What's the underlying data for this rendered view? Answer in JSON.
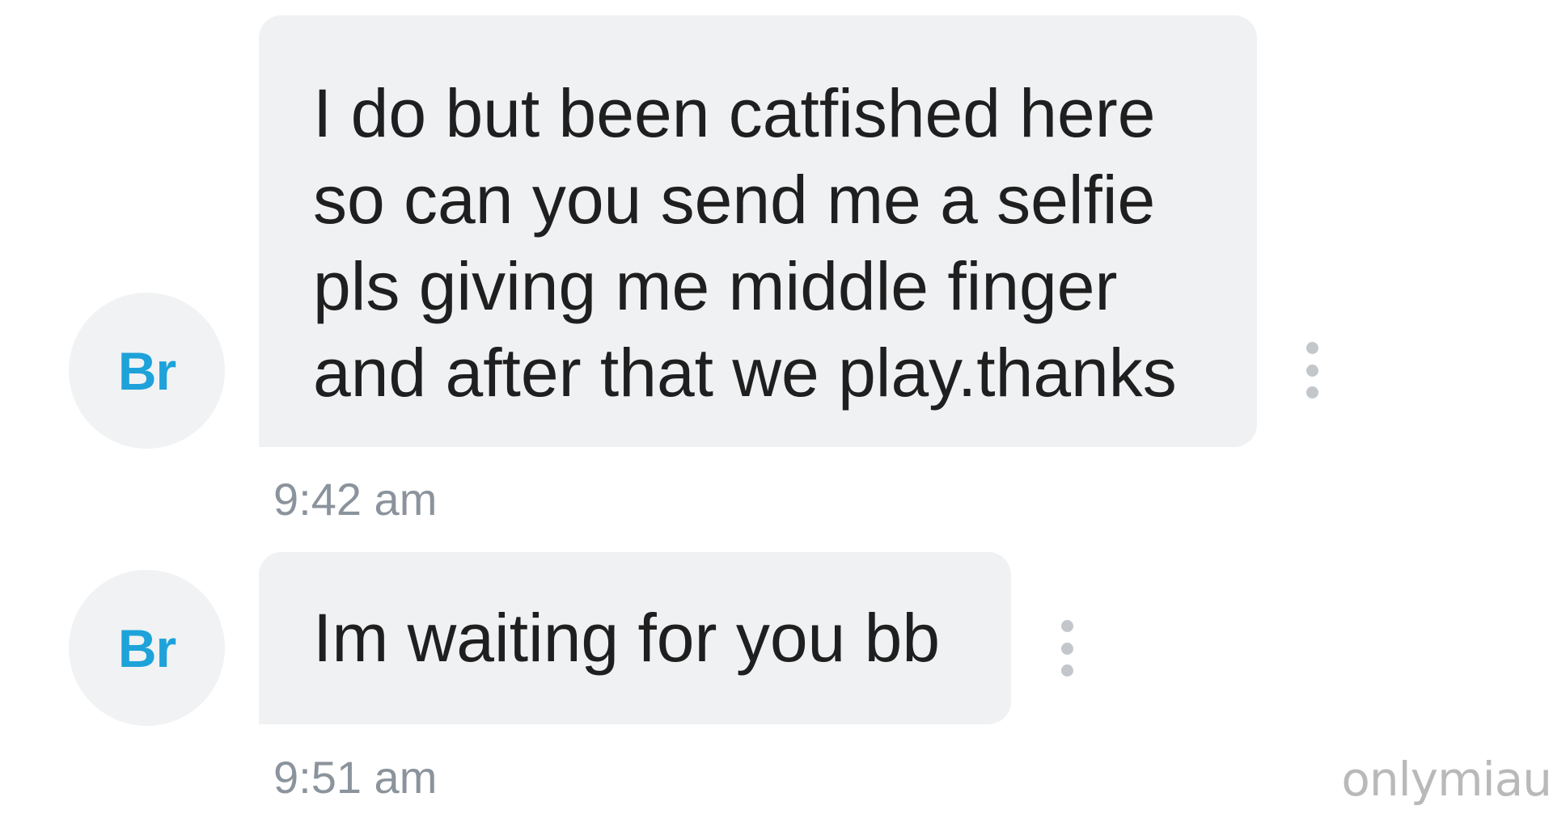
{
  "messages": [
    {
      "avatar_initials": "Br",
      "text": "I do but been catfished here\nso can you send me a selfie\npls giving me middle finger\nand after that we play.thanks",
      "time": "9:42 am"
    },
    {
      "avatar_initials": "Br",
      "text": "Im waiting for you bb",
      "time": "9:51 am"
    }
  ],
  "watermark": "onlymiau",
  "colors": {
    "avatar_text": "#1ea2da",
    "avatar_bg": "#f0f2f4",
    "bubble_bg": "#f0f1f3",
    "timestamp": "#8b939c"
  },
  "icons": {
    "message_options": "more-vertical-icon"
  }
}
